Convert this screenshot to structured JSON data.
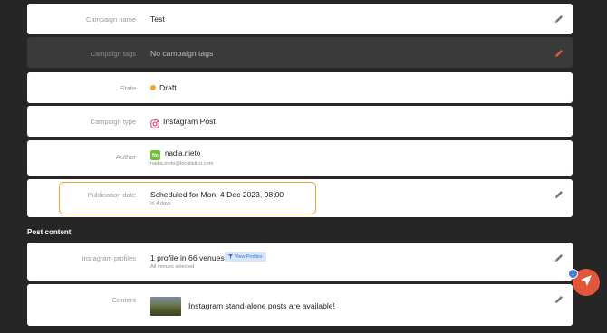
{
  "fields": {
    "campaign_name": {
      "label": "Campaign name",
      "value": "Test"
    },
    "campaign_tags": {
      "label": "Campaign tags",
      "value": "No campaign tags"
    },
    "state": {
      "label": "State",
      "value": "Draft",
      "status_color": "#f0a336"
    },
    "campaign_type": {
      "label": "Campaign type",
      "value": "Instagram Post",
      "icon": "instagram-icon"
    },
    "author": {
      "label": "Author",
      "initials": "No",
      "name": "nadia.nieto",
      "email": "nadia.nieto@localistico.com"
    },
    "publication_date": {
      "label": "Publication date",
      "value": "Scheduled for Mon, 4 Dec 2023, 08:00",
      "sub": "In 4 days"
    }
  },
  "post_content": {
    "title": "Post content",
    "instagram_profiles": {
      "label": "Instagram profiles",
      "value": "1 profile in 66 venues",
      "sub": "All venues selected",
      "button_label": "View Profiles"
    },
    "content": {
      "label": "Content",
      "value": "Instagram stand-alone posts are available!"
    }
  },
  "fab": {
    "badge_count": "1"
  },
  "colors": {
    "accent": "#f0a336",
    "edit_active": "#e2573b",
    "fab": "#e2573b",
    "badge": "#3d7de0"
  }
}
